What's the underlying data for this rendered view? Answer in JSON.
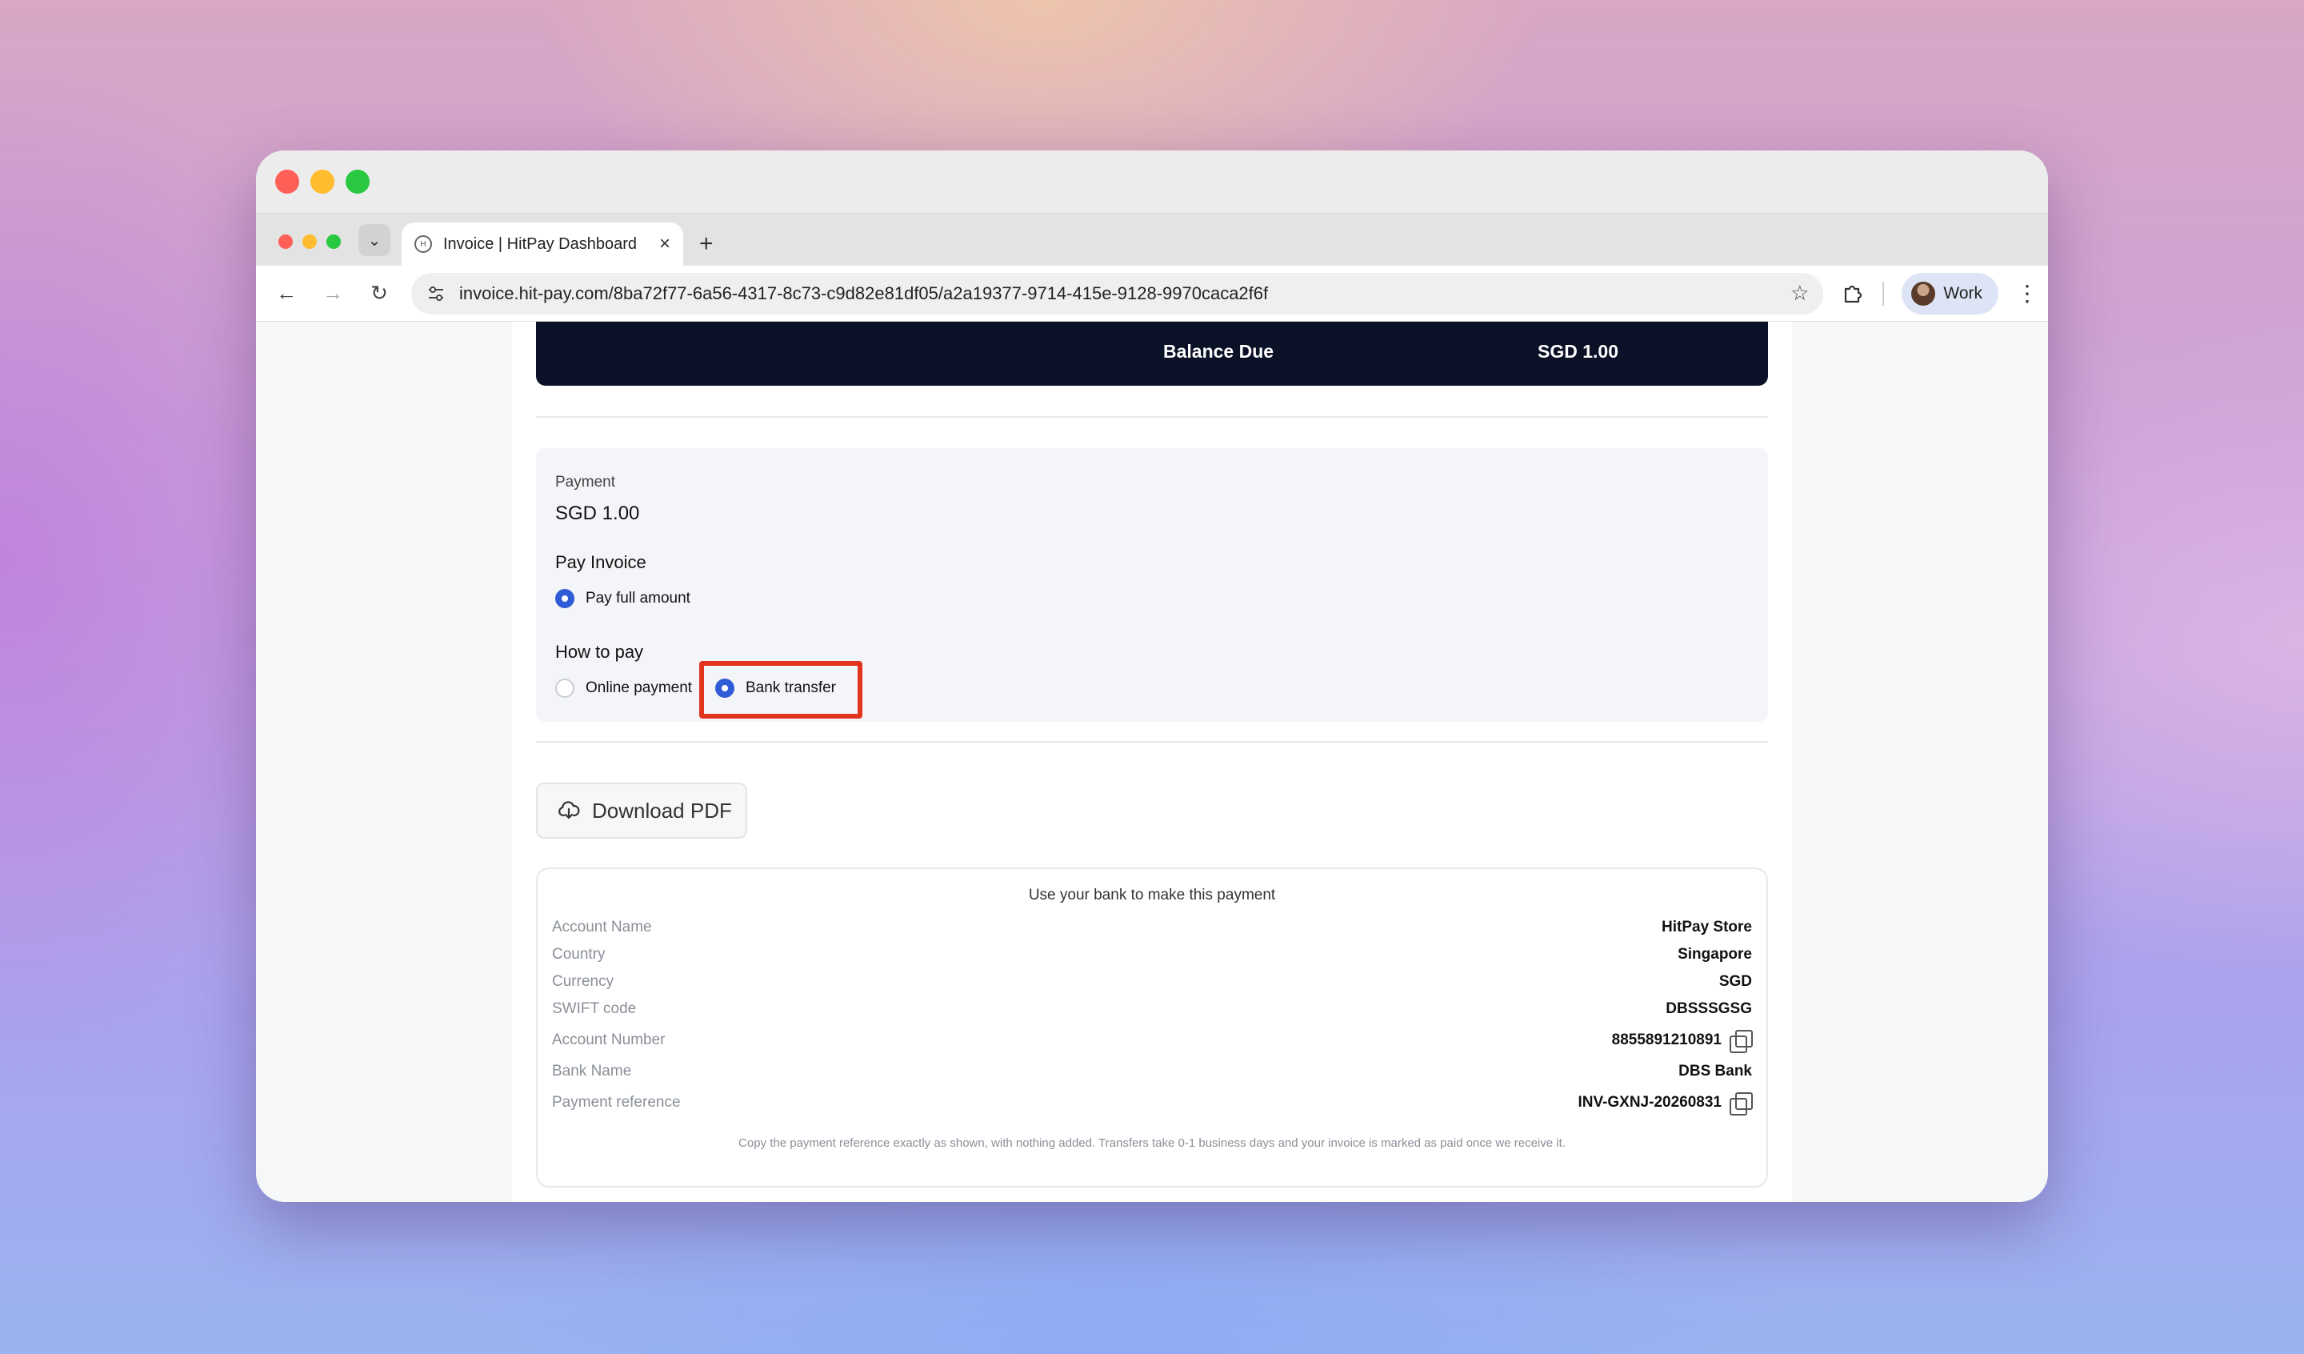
{
  "browser": {
    "tab_title": "Invoice | HitPay Dashboard",
    "url": "invoice.hit-pay.com/8ba72f77-6a56-4317-8c73-c9d82e81df05/a2a19377-9714-415e-9128-9970caca2f6f",
    "profile_label": "Work"
  },
  "invoice": {
    "balance_label": "Balance Due",
    "balance_value": "SGD 1.00"
  },
  "payment": {
    "label": "Payment",
    "amount": "SGD 1.00",
    "pay_invoice_heading": "Pay Invoice",
    "pay_full_label": "Pay full amount",
    "how_to_pay_heading": "How to pay",
    "online_label": "Online payment",
    "bank_label": "Bank transfer"
  },
  "download": {
    "label": "Download PDF"
  },
  "bank": {
    "title": "Use your bank to make this payment",
    "rows": [
      {
        "key": "Account Name",
        "value": "HitPay Store"
      },
      {
        "key": "Country",
        "value": "Singapore"
      },
      {
        "key": "Currency",
        "value": "SGD"
      },
      {
        "key": "SWIFT code",
        "value": "DBSSSGSG"
      },
      {
        "key": "Account Number",
        "value": "8855891210891"
      },
      {
        "key": "Bank Name",
        "value": "DBS Bank"
      },
      {
        "key": "Payment reference",
        "value": "INV-GXNJ-20260831"
      }
    ],
    "note": "Copy the payment reference exactly as shown, with nothing added. Transfers take 0-1 business days and your invoice is marked as paid once we receive it."
  },
  "colors": {
    "accent": "#2f5bd6",
    "highlight": "#e2331e",
    "balance_bar": "#0b1127"
  }
}
